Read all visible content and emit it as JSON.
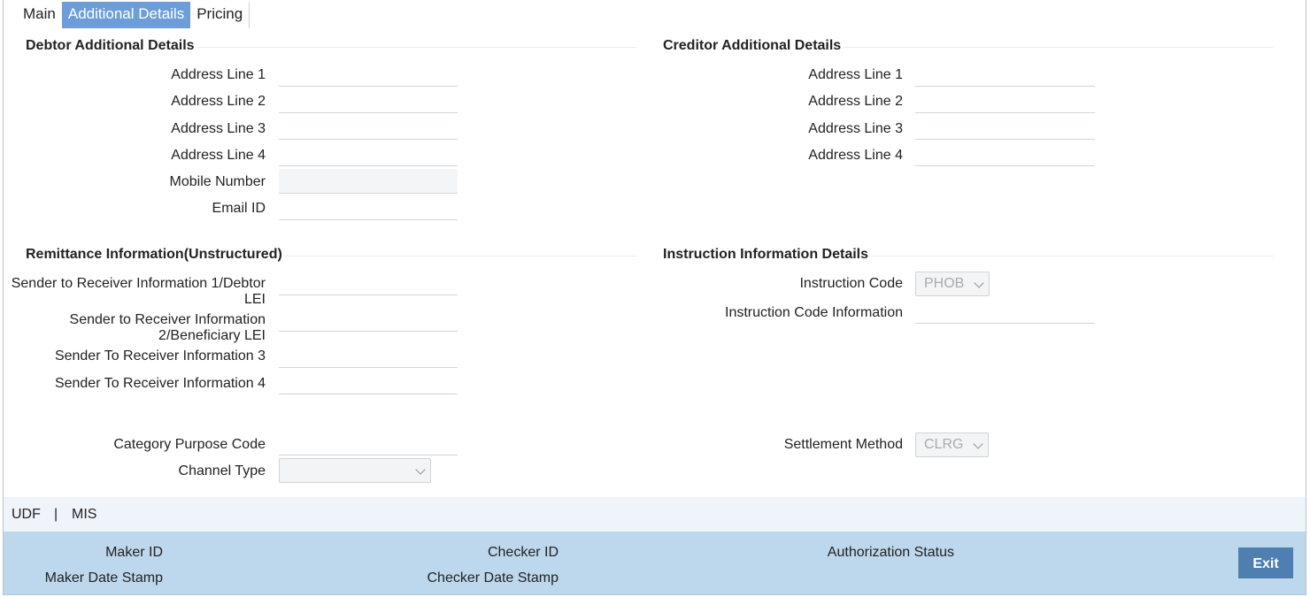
{
  "tabs": [
    {
      "label": "Main"
    },
    {
      "label": "Additional Details"
    },
    {
      "label": "Pricing"
    }
  ],
  "debtor": {
    "title": "Debtor Additional Details",
    "address1": "Address Line 1",
    "address2": "Address Line 2",
    "address3": "Address Line 3",
    "address4": "Address Line 4",
    "mobile": "Mobile Number",
    "email": "Email ID"
  },
  "creditor": {
    "title": "Creditor Additional Details",
    "address1": "Address Line 1",
    "address2": "Address Line 2",
    "address3": "Address Line 3",
    "address4": "Address Line 4"
  },
  "remittance": {
    "title": "Remittance Information(Unstructured)",
    "info1": "Sender to Receiver Information 1/Debtor LEI",
    "info2": "Sender to Receiver Information 2/Beneficiary LEI",
    "info3": "Sender To Receiver Information 3",
    "info4": "Sender To Receiver Information 4"
  },
  "instruction": {
    "title": "Instruction Information Details",
    "code_label": "Instruction Code",
    "code_value": "PHOB",
    "info_label": "Instruction Code Information"
  },
  "misc": {
    "category_label": "Category Purpose Code",
    "channel_label": "Channel Type",
    "channel_value": "",
    "settlement_label": "Settlement Method",
    "settlement_value": "CLRG"
  },
  "links": {
    "udf": "UDF",
    "sep": "|",
    "mis": "MIS"
  },
  "footer": {
    "maker_id": "Maker ID",
    "maker_date": "Maker Date Stamp",
    "checker_id": "Checker ID",
    "checker_date": "Checker Date Stamp",
    "auth_status": "Authorization Status",
    "exit": "Exit"
  }
}
